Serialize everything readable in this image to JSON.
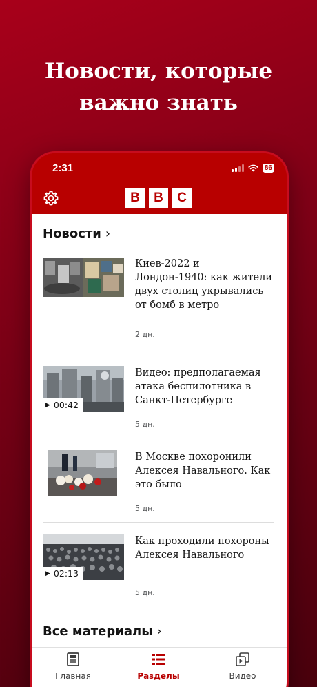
{
  "promo": {
    "line1": "Новости, которые",
    "line2": "важно знать"
  },
  "status": {
    "time": "2:31",
    "battery": "86"
  },
  "appbar": {
    "logo": [
      "B",
      "B",
      "C"
    ]
  },
  "sections": {
    "news": "Новости",
    "all": "Все материалы"
  },
  "articles": [
    {
      "headline": "Киев-2022 и Лондон-1940: как жители двух столиц укрывались от бомб в метро",
      "age": "2 дн.",
      "duration": ""
    },
    {
      "headline": "Видео: предполагаемая атака беспилотника в Санкт-Петербурге",
      "age": "5 дн.",
      "duration": "00:42"
    },
    {
      "headline": "В Москве похоронили Алексея Навального. Как это было",
      "age": "5 дн.",
      "duration": ""
    },
    {
      "headline": "Как проходили похороны Алексея Навального",
      "age": "5 дн.",
      "duration": "02:13"
    }
  ],
  "tabs": [
    {
      "label": "Главная",
      "icon": "newspaper-icon"
    },
    {
      "label": "Разделы",
      "icon": "list-icon"
    },
    {
      "label": "Видео",
      "icon": "video-stack-icon"
    }
  ],
  "colors": {
    "brand": "#b80000",
    "background_top": "#a8001a",
    "background_bottom": "#4a000d"
  }
}
